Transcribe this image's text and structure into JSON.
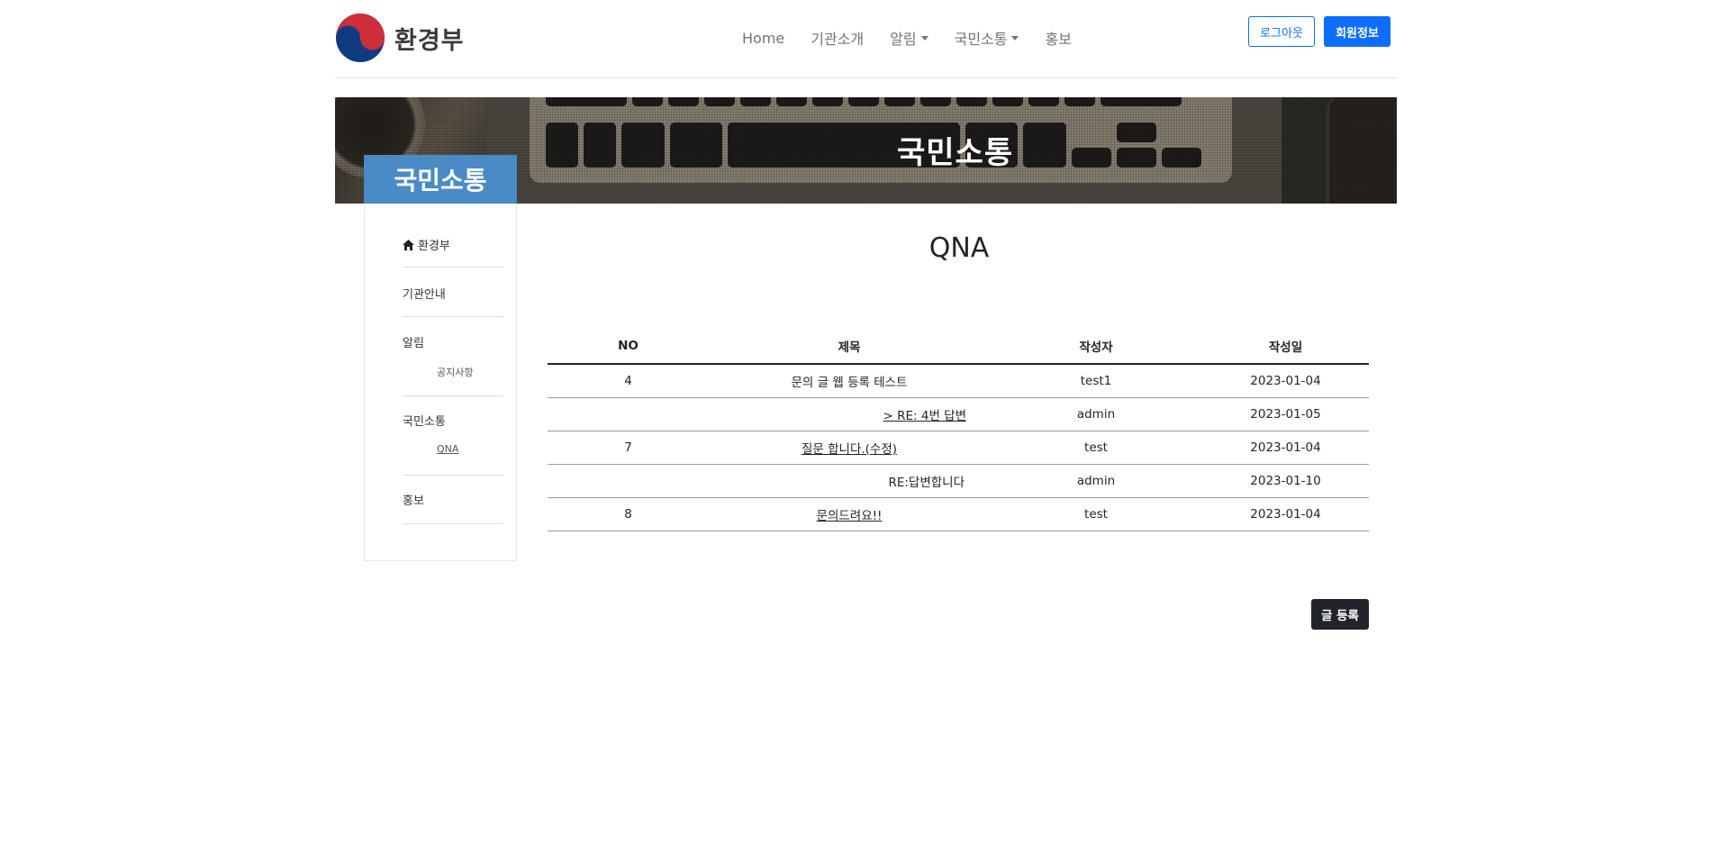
{
  "brand": {
    "name": "환경부"
  },
  "nav": {
    "items": [
      {
        "label": "Home",
        "dropdown": false
      },
      {
        "label": "기관소개",
        "dropdown": false
      },
      {
        "label": "알림",
        "dropdown": true
      },
      {
        "label": "국민소통",
        "dropdown": true
      },
      {
        "label": "홍보",
        "dropdown": false
      }
    ],
    "logout_label": "로그아웃",
    "member_label": "회원정보"
  },
  "banner": {
    "title": "국민소통"
  },
  "sidebar": {
    "title": "국민소통",
    "items": [
      {
        "label": "환경부",
        "icon": "home-icon",
        "subitems": []
      },
      {
        "label": "기관안내",
        "subitems": []
      },
      {
        "label": "알림",
        "subitems": [
          "공지사항"
        ]
      },
      {
        "label": "국민소통",
        "subitems": [
          "QNA"
        ]
      },
      {
        "label": "홍보",
        "subitems": []
      }
    ]
  },
  "main": {
    "title": "QNA",
    "table": {
      "headers": [
        "NO",
        "제목",
        "작성자",
        "작성일"
      ],
      "rows": [
        {
          "no": "4",
          "title": "문의 글 웹 등록 테스트",
          "author": "test1",
          "date": "2023-01-04",
          "link": false
        },
        {
          "no": "",
          "title": "> RE: 4번 답변",
          "author": "admin",
          "date": "2023-01-05",
          "link": true
        },
        {
          "no": "7",
          "title": "질문 합니다.(수정)",
          "author": "test",
          "date": "2023-01-04",
          "link": true
        },
        {
          "no": "",
          "title": "RE:답변합니다",
          "author": "admin",
          "date": "2023-01-10",
          "link": false
        },
        {
          "no": "8",
          "title": "문의드려요!!",
          "author": "test",
          "date": "2023-01-04",
          "link": true
        }
      ]
    },
    "write_label": "글 등록"
  },
  "colors": {
    "primary": "#0d6efd",
    "sidebar_header": "#4a8bc5",
    "dark_button": "#212529",
    "logo_red": "#cd2e3a",
    "logo_blue": "#0f3b82"
  }
}
